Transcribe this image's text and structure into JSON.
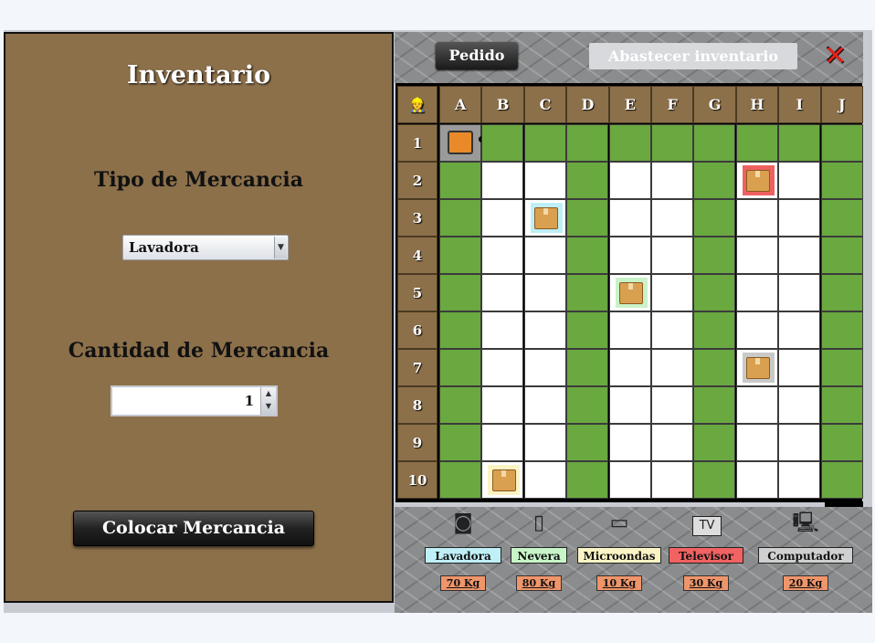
{
  "left_panel": {
    "title": "Inventario",
    "tipo_label": "Tipo de Mercancia",
    "tipo_selected": "Lavadora",
    "cantidad_label": "Cantidad de Mercancia",
    "cantidad_value": "1",
    "colocar_label": "Colocar Mercancia"
  },
  "toolbar": {
    "pedido_label": "Pedido",
    "abastecer_label": "Abastecer inventario"
  },
  "grid": {
    "columns": [
      "A",
      "B",
      "C",
      "D",
      "E",
      "F",
      "G",
      "H",
      "I",
      "J"
    ],
    "rows": [
      "1",
      "2",
      "3",
      "4",
      "5",
      "6",
      "7",
      "8",
      "9",
      "10"
    ],
    "green_columns": [
      "A",
      "D",
      "G",
      "J"
    ],
    "green_rows": [
      "1"
    ],
    "robot_cell": "A1",
    "items": [
      {
        "cell": "H2",
        "color": "#f06060"
      },
      {
        "cell": "C3",
        "color": "#bfeff6"
      },
      {
        "cell": "E5",
        "color": "#c9f3c9"
      },
      {
        "cell": "H7",
        "color": "#c9c9c9"
      },
      {
        "cell": "B10",
        "color": "#fbf3c4"
      }
    ]
  },
  "legend": [
    {
      "label": "Lavadora",
      "weight": "70 Kg",
      "color": "#bff0f7",
      "icon": "washing-machine-icon"
    },
    {
      "label": "Nevera",
      "weight": "80 Kg",
      "color": "#c8f5c8",
      "icon": "fridge-icon"
    },
    {
      "label": "Microondas",
      "weight": "10 Kg",
      "color": "#fbf5c6",
      "icon": "microwave-icon"
    },
    {
      "label": "Televisor",
      "weight": "30 Kg",
      "color": "#f26262",
      "icon": "tv-icon"
    },
    {
      "label": "Computador",
      "weight": "20 Kg",
      "color": "#d0d0d0",
      "icon": "computer-icon"
    }
  ]
}
